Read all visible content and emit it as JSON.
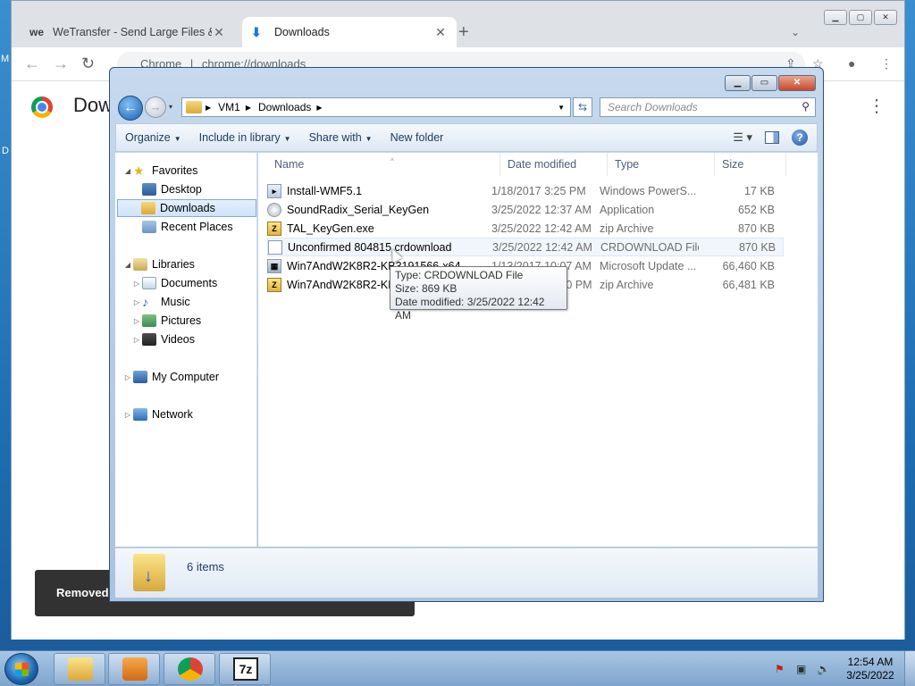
{
  "desktop": {
    "frag_left_1": "M",
    "frag_left_2": "D"
  },
  "chrome": {
    "tabs": [
      {
        "favicon": "we",
        "title": "WeTransfer - Send Large Files &",
        "close": "✕"
      },
      {
        "favicon": "⬇",
        "title": "Downloads",
        "close": "✕"
      }
    ],
    "new_tab": "+",
    "tab_menu": "⌄",
    "win_buttons": {
      "minimize": "▁",
      "maximize": "▢",
      "close": "✕"
    },
    "nav": {
      "back": "←",
      "forward": "→",
      "reload": "↻"
    },
    "omnibox": {
      "site": "Chrome",
      "divider": "|",
      "url": "chrome://downloads"
    },
    "toolbar_right": {
      "share": "⇪",
      "star": "☆",
      "profile": "●",
      "menu": "⋮"
    },
    "page": {
      "title": "Dow",
      "menu": "⋮",
      "snackbar": "Removed '"
    }
  },
  "explorer": {
    "win_buttons": {
      "minimize": "▁",
      "maximize": "▭",
      "close": "✕"
    },
    "nav_back": "←",
    "nav_forward": "→",
    "nav_dropdown": "▾",
    "breadcrumb": [
      "VM1",
      "Downloads"
    ],
    "breadcrumb_sep": "▶",
    "address_dropdown": "▼",
    "refresh": "⇆",
    "search_placeholder": "Search Downloads",
    "search_icon": "⚲",
    "commands": {
      "organize": "Organize",
      "include_in_library": "Include in library",
      "share_with": "Share with",
      "new_folder": "New folder",
      "caret": "▼",
      "view": "☰ ▾",
      "help": "?"
    },
    "nav_pane": {
      "expand": "◢",
      "collapse": "▷",
      "favorites": "Favorites",
      "desktop": "Desktop",
      "downloads": "Downloads",
      "recent_places": "Recent Places",
      "libraries": "Libraries",
      "documents": "Documents",
      "music": "Music",
      "pictures": "Pictures",
      "videos": "Videos",
      "my_computer": "My Computer",
      "network": "Network",
      "star": "★",
      "note": "♪"
    },
    "columns": {
      "name": "Name",
      "date": "Date modified",
      "type": "Type",
      "size": "Size",
      "sort_arrow": "^"
    },
    "files": [
      {
        "icon": "ps",
        "glyph": "▸",
        "name": "Install-WMF5.1",
        "date": "1/18/2017 3:25 PM",
        "type": "Windows PowerS...",
        "size": "17 KB"
      },
      {
        "icon": "app",
        "glyph": "",
        "name": "SoundRadix_Serial_KeyGen",
        "date": "3/25/2022 12:37 AM",
        "type": "Application",
        "size": "652 KB"
      },
      {
        "icon": "zip",
        "glyph": "Z",
        "name": "TAL_KeyGen.exe",
        "date": "3/25/2022 12:42 AM",
        "type": "zip Archive",
        "size": "870 KB"
      },
      {
        "icon": "blank",
        "glyph": "",
        "name": "Unconfirmed 804815.crdownload",
        "date": "3/25/2022 12:42 AM",
        "type": "CRDOWNLOAD File",
        "size": "870 KB"
      },
      {
        "icon": "msu",
        "glyph": "▦",
        "name": "Win7AndW2K8R2-KB3191566-x64",
        "date": "1/13/2017 10:07 AM",
        "type": "Microsoft Update ...",
        "size": "66,460 KB"
      },
      {
        "icon": "zip",
        "glyph": "Z",
        "name": "Win7AndW2K8R2-KB3191566-x64",
        "date": "3/25/2022 12:40 PM",
        "type": "zip Archive",
        "size": "66,481 KB"
      }
    ],
    "tooltip": {
      "type": "Type: CRDOWNLOAD File",
      "size": "Size: 869 KB",
      "date": "Date modified: 3/25/2022 12:42 AM"
    },
    "details": {
      "count": "6 items"
    }
  },
  "taskbar": {
    "seven_zip": "7z",
    "tray": {
      "flag": "⚑",
      "network": "▣",
      "volume": "🔈"
    },
    "time": "12:54 AM",
    "date": "3/25/2022"
  }
}
